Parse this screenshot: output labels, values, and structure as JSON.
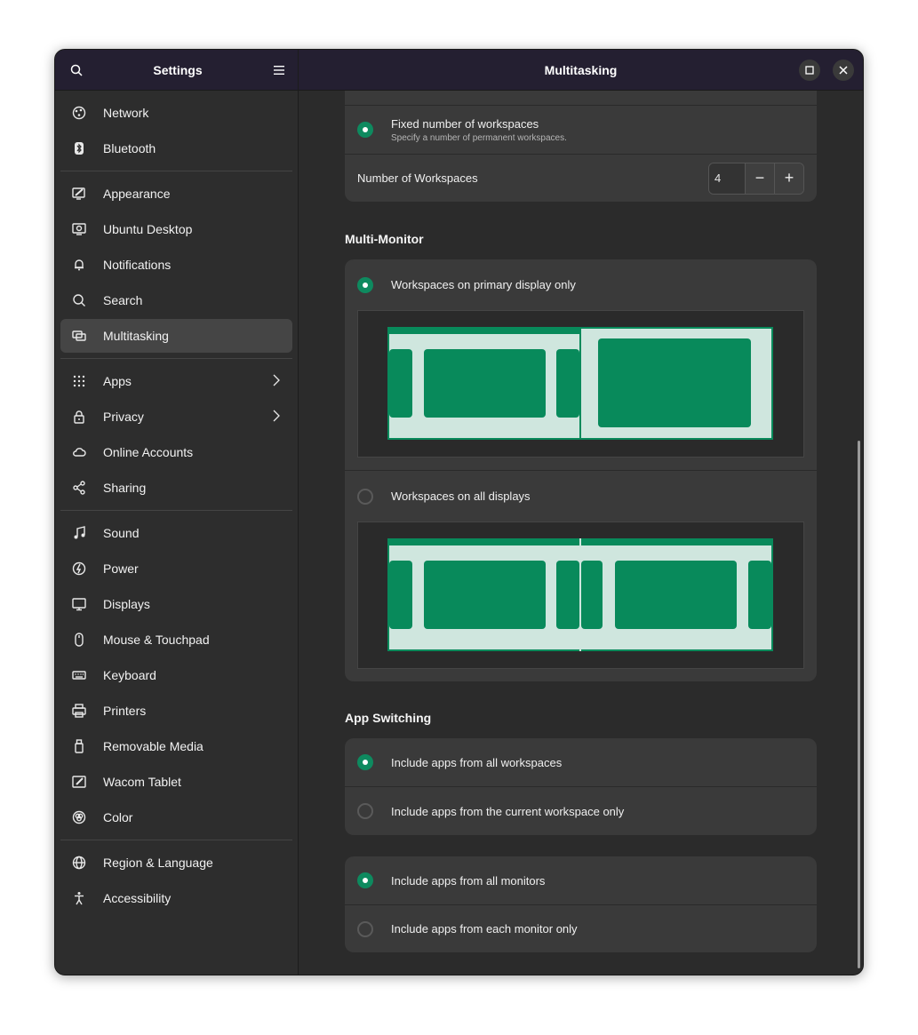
{
  "sidebar": {
    "title": "Settings",
    "groups": [
      [
        {
          "label": "Network",
          "icon": "network-icon"
        },
        {
          "label": "Bluetooth",
          "icon": "bluetooth-icon"
        }
      ],
      [
        {
          "label": "Appearance",
          "icon": "appearance-icon"
        },
        {
          "label": "Ubuntu Desktop",
          "icon": "ubuntu-desktop-icon"
        },
        {
          "label": "Notifications",
          "icon": "bell-icon"
        },
        {
          "label": "Search",
          "icon": "search-icon"
        },
        {
          "label": "Multitasking",
          "icon": "multitasking-icon",
          "active": true
        }
      ],
      [
        {
          "label": "Apps",
          "icon": "apps-grid-icon",
          "chevron": true
        },
        {
          "label": "Privacy",
          "icon": "lock-icon",
          "chevron": true
        },
        {
          "label": "Online Accounts",
          "icon": "cloud-icon"
        },
        {
          "label": "Sharing",
          "icon": "share-icon"
        }
      ],
      [
        {
          "label": "Sound",
          "icon": "music-note-icon"
        },
        {
          "label": "Power",
          "icon": "power-icon"
        },
        {
          "label": "Displays",
          "icon": "display-icon"
        },
        {
          "label": "Mouse & Touchpad",
          "icon": "mouse-icon"
        },
        {
          "label": "Keyboard",
          "icon": "keyboard-icon"
        },
        {
          "label": "Printers",
          "icon": "printer-icon"
        },
        {
          "label": "Removable Media",
          "icon": "usb-drive-icon"
        },
        {
          "label": "Wacom Tablet",
          "icon": "tablet-icon"
        },
        {
          "label": "Color",
          "icon": "color-icon"
        }
      ],
      [
        {
          "label": "Region & Language",
          "icon": "globe-icon"
        },
        {
          "label": "Accessibility",
          "icon": "accessibility-icon"
        }
      ]
    ]
  },
  "header": {
    "title": "Multitasking"
  },
  "workspaces": {
    "fixed_label": "Fixed number of workspaces",
    "fixed_sub": "Specify a number of permanent workspaces.",
    "number_label": "Number of Workspaces",
    "number_value": "4",
    "minus": "−",
    "plus": "+"
  },
  "multi_monitor": {
    "title": "Multi-Monitor",
    "primary_label": "Workspaces on primary display only",
    "all_label": "Workspaces on all displays"
  },
  "app_switching": {
    "title": "App Switching",
    "all_workspaces": "Include apps from all workspaces",
    "current_workspace": "Include apps from the current workspace only",
    "all_monitors": "Include apps from all monitors",
    "each_monitor": "Include apps from each monitor only"
  },
  "colors": {
    "accent": "#0e8a5f",
    "illus_light": "#cfe6de",
    "illus_green": "#088a5b"
  }
}
